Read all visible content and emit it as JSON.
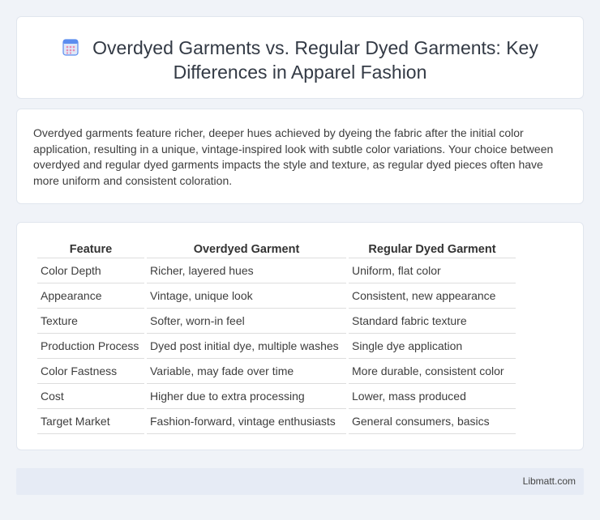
{
  "header": {
    "icon": "calendar-grid-icon",
    "title_line1": "Overdyed Garments vs. Regular Dyed Garments: Key",
    "title_line2": "Differences in Apparel Fashion"
  },
  "description": "Overdyed garments feature richer, deeper hues achieved by dyeing the fabric after the initial color application, resulting in a unique, vintage-inspired look with subtle color variations. Your choice between overdyed and regular dyed garments impacts the style and texture, as regular dyed pieces often have more uniform and consistent coloration.",
  "table": {
    "headers": [
      "Feature",
      "Overdyed Garment",
      "Regular Dyed Garment"
    ],
    "rows": [
      [
        "Color Depth",
        "Richer, layered hues",
        "Uniform, flat color"
      ],
      [
        "Appearance",
        "Vintage, unique look",
        "Consistent, new appearance"
      ],
      [
        "Texture",
        "Softer, worn-in feel",
        "Standard fabric texture"
      ],
      [
        "Production Process",
        "Dyed post initial dye, multiple washes",
        "Single dye application"
      ],
      [
        "Color Fastness",
        "Variable, may fade over time",
        "More durable, consistent color"
      ],
      [
        "Cost",
        "Higher due to extra processing",
        "Lower, mass produced"
      ],
      [
        "Target Market",
        "Fashion-forward, vintage enthusiasts",
        "General consumers, basics"
      ]
    ]
  },
  "footer": {
    "text": "Libmatt.com"
  },
  "colors": {
    "background": "#f0f3f8",
    "card": "#ffffff",
    "footer": "#e6ebf5",
    "icon_blue": "#5b8def",
    "icon_pink": "#e88ab4"
  }
}
